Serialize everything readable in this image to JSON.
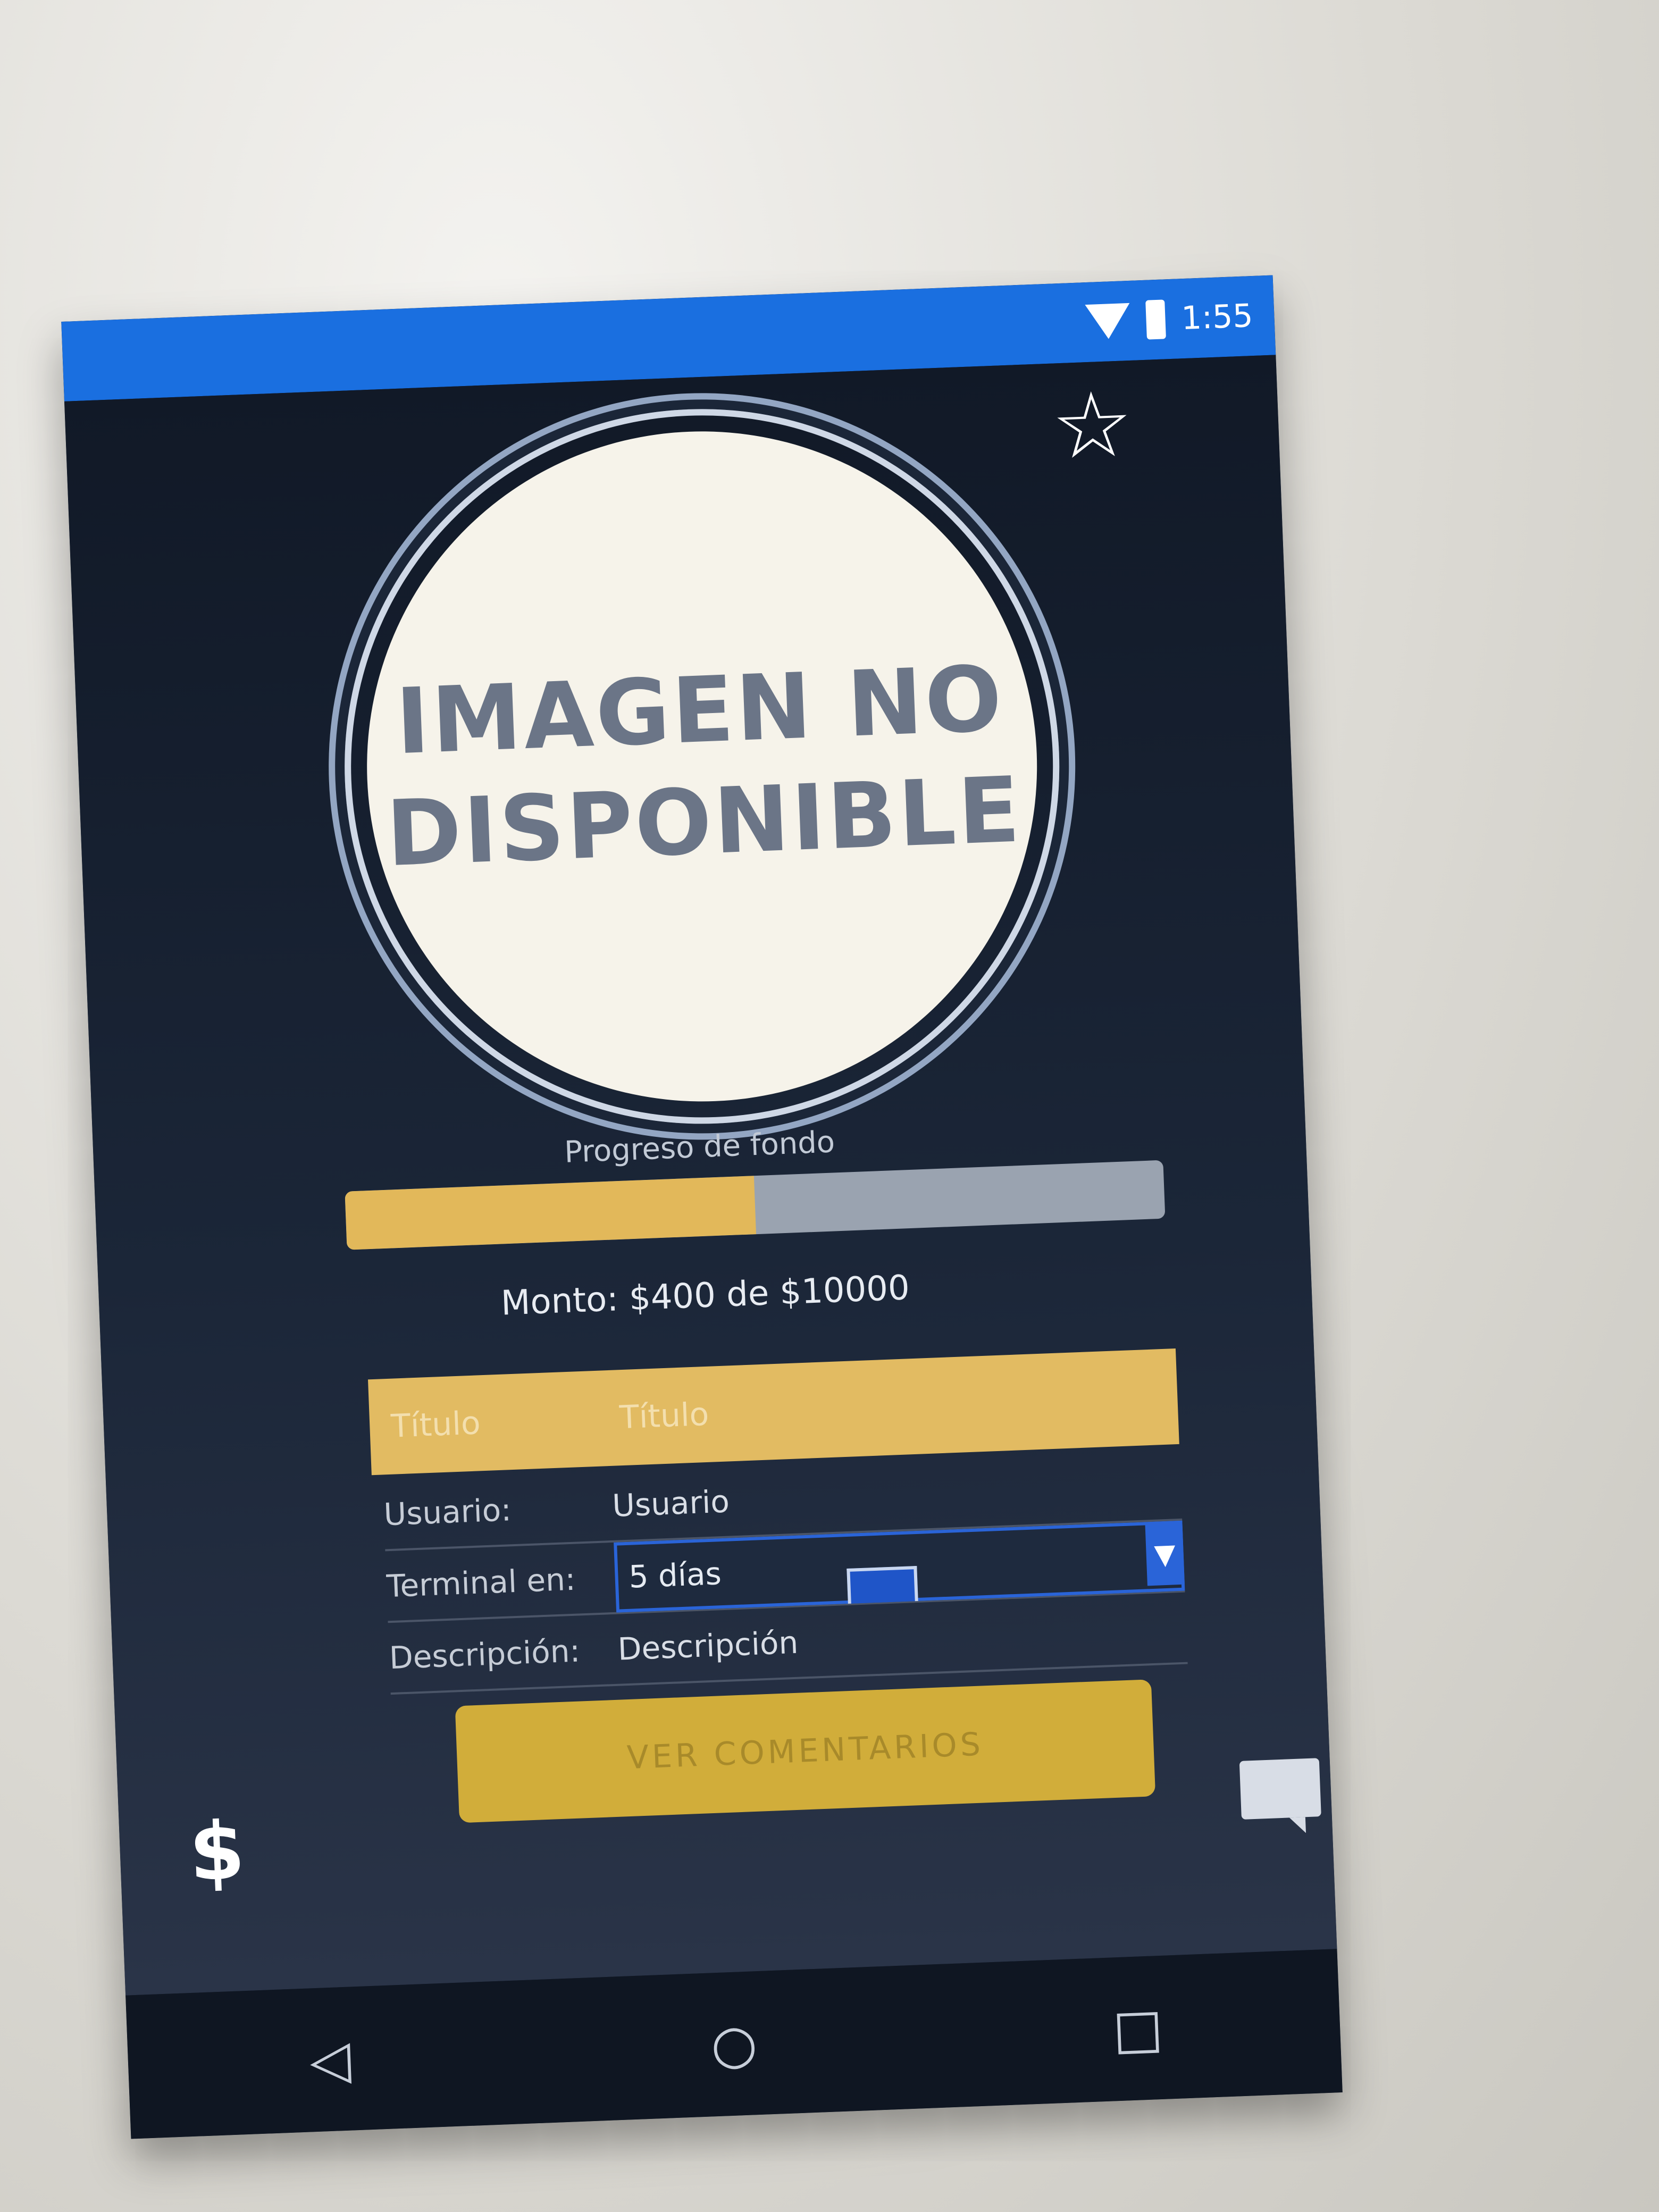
{
  "status_bar": {
    "time": "1:55",
    "wifi_icon": "wifi-icon",
    "battery_icon": "battery-icon"
  },
  "header": {
    "favorite_icon": "star-outline-icon",
    "favorite_glyph": "☆"
  },
  "image": {
    "placeholder_line1": "IMAGEN NO",
    "placeholder_line2": "DISPONIBLE"
  },
  "progress": {
    "caption": "Progreso de fondo",
    "fraction": 0.5
  },
  "amount": {
    "text": "Monto: $400 de $10000"
  },
  "table": {
    "header": {
      "col1": "Título",
      "col2": "Título"
    },
    "rows": [
      {
        "label": "Usuario:",
        "value": "Usuario"
      },
      {
        "label": "Terminal en:",
        "value": "5 días"
      },
      {
        "label": "Descripción:",
        "value": "Descripción"
      }
    ]
  },
  "button": {
    "label": "VER COMENTARIOS"
  },
  "bottom": {
    "money_icon": "dollar-icon",
    "money_glyph": "$",
    "comment_icon": "comment-icon"
  },
  "nav": {
    "back": "◁",
    "home": "○",
    "recents": "□"
  },
  "colors": {
    "status_bar": "#1a6fe0",
    "accent_gold": "#e2bb62",
    "button_gold": "#d1ad3a",
    "background": "#1a2434"
  }
}
